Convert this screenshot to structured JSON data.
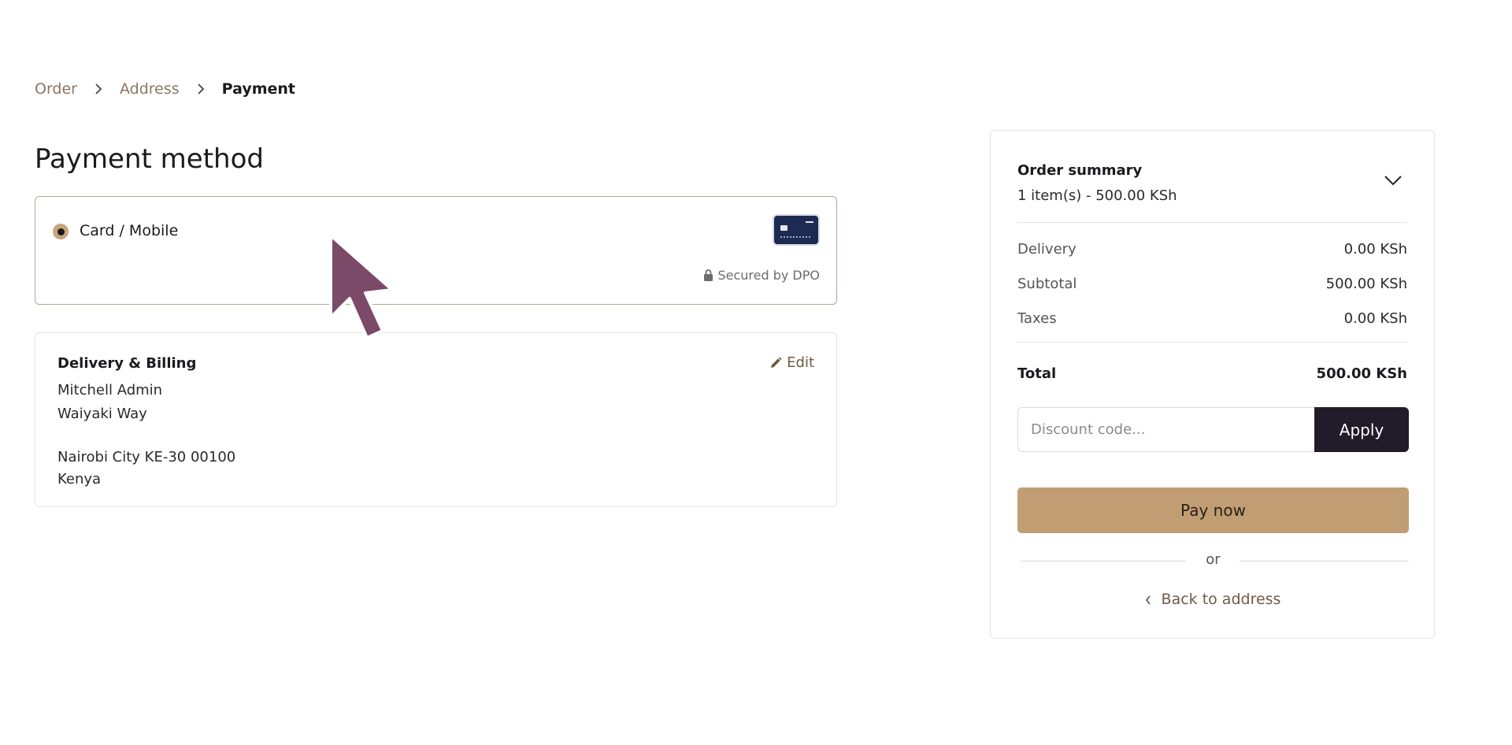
{
  "breadcrumb": {
    "items": [
      "Order",
      "Address"
    ],
    "current": "Payment"
  },
  "page": {
    "title": "Payment method"
  },
  "payment_option": {
    "label": "Card / Mobile",
    "selected": true,
    "icon": "credit-card-icon",
    "secured_text": "Secured by DPO"
  },
  "billing": {
    "title": "Delivery & Billing",
    "edit_label": "Edit",
    "name": "Mitchell Admin",
    "street": "Waiyaki Way",
    "city_line": "Nairobi City KE-30 00100",
    "country": "Kenya"
  },
  "summary": {
    "title": "Order summary",
    "items_text": "1 item(s) -  500.00 KSh",
    "rows": [
      {
        "label": "Delivery",
        "value": "0.00 KSh"
      },
      {
        "label": "Subtotal",
        "value": "500.00 KSh"
      },
      {
        "label": "Taxes",
        "value": "0.00 KSh"
      }
    ],
    "total_label": "Total",
    "total_value": "500.00 KSh",
    "discount_placeholder": "Discount code...",
    "apply_label": "Apply",
    "pay_label": "Pay now",
    "or_text": "or",
    "back_label": "Back to address"
  },
  "colors": {
    "accent": "#c19d74",
    "dark": "#221b2a",
    "link": "#8b7760",
    "cursor": "#7a4a68"
  }
}
